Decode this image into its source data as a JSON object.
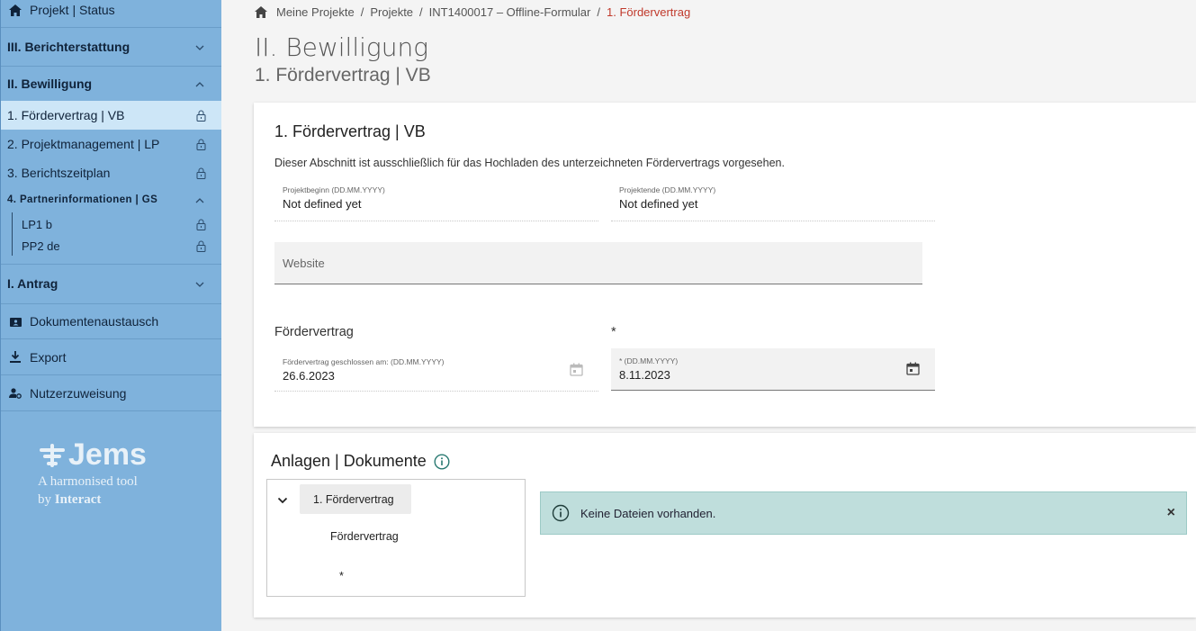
{
  "sidebar": {
    "project_status": "Projekt | Status",
    "reporting": "III. Berichterstattung",
    "approval": "II. Bewilligung",
    "approval_items": [
      {
        "label": "1. Fördervertrag | VB"
      },
      {
        "label": "2. Projektmanagement | LP"
      },
      {
        "label": "3. Berichtszeitplan"
      }
    ],
    "partner_info": "4. Partnerinformationen | GS",
    "partners": [
      {
        "label": "LP1 b"
      },
      {
        "label": "PP2 de"
      }
    ],
    "application": "I. Antrag",
    "documents": "Dokumentenaustausch",
    "export": "Export",
    "user_assignment": "Nutzerzuweisung",
    "logo": {
      "word": "Jems",
      "tagline1": "A harmonised tool",
      "tagline2_prefix": "by",
      "tagline2_brand": "Interact"
    }
  },
  "breadcrumb": {
    "items": [
      "Meine Projekte",
      "Projekte",
      "INT1400017 – Offline-Formular"
    ],
    "current": "1. Fördervertrag",
    "separator": "/"
  },
  "page": {
    "title": "II. Bewilligung",
    "subtitle": "1. Fördervertrag | VB"
  },
  "contract_card": {
    "title": "1. Fördervertrag | VB",
    "description": "Dieser Abschnitt ist ausschließlich für das Hochladen des unterzeichneten Fördervertrags vorgesehen.",
    "project_start_label": "Projektbeginn (DD.MM.YYYY)",
    "project_start_value": "Not defined yet",
    "project_end_label": "Projektende (DD.MM.YYYY)",
    "project_end_value": "Not defined yet",
    "website_placeholder": "Website",
    "section_label": "Fördervertrag",
    "section_star": "*",
    "concluded_label": "Fördervertrag geschlossen am: (DD.MM.YYYY)",
    "concluded_value": "26.6.2023",
    "date_label": "* (DD.MM.YYYY)",
    "date_value": "8.11.2023"
  },
  "attachments_card": {
    "title": "Anlagen | Dokumente",
    "tree_node": "1. Fördervertrag",
    "tree_leaf": "Fördervertrag",
    "tree_leaf2": "*",
    "alert_message": "Keine Dateien vorhanden.",
    "alert_close": "×"
  },
  "colors": {
    "sidebar_bg": "#7fb2dc",
    "sidebar_active": "#cde6f7",
    "breadcrumb_current": "#c0392b",
    "alert_bg": "#bfdedc",
    "info_icon": "#2a7a72"
  }
}
